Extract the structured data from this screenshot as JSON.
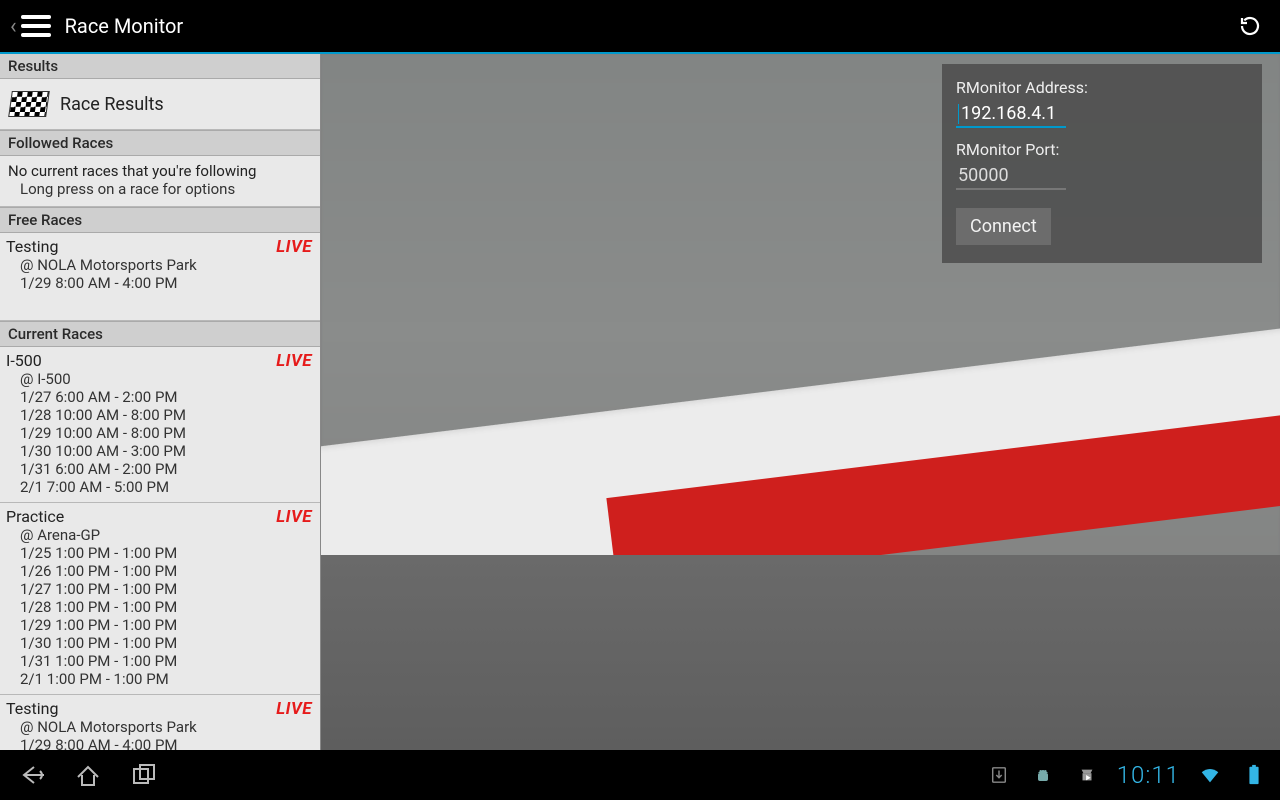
{
  "actionbar": {
    "title": "Race Monitor"
  },
  "sidebar": {
    "sections": {
      "results": {
        "header": "Results",
        "race_results_label": "Race Results"
      },
      "followed": {
        "header": "Followed Races",
        "empty_line": "No current races that you're following",
        "hint": "Long press on a race for options"
      },
      "free": {
        "header": "Free Races"
      },
      "current": {
        "header": "Current Races"
      }
    },
    "free_races": [
      {
        "title": "Testing",
        "live": "LIVE",
        "venue": "@ NOLA Motorsports Park",
        "schedule": [
          "1/29  8:00 AM - 4:00 PM"
        ]
      }
    ],
    "current_races": [
      {
        "title": "I-500",
        "live": "LIVE",
        "venue": "@ I-500",
        "schedule": [
          "1/27  6:00 AM - 2:00 PM",
          "1/28  10:00 AM - 8:00 PM",
          "1/29  10:00 AM - 8:00 PM",
          "1/30  10:00 AM - 3:00 PM",
          "1/31  6:00 AM - 2:00 PM",
          "2/1  7:00 AM - 5:00 PM"
        ]
      },
      {
        "title": "Practice",
        "live": "LIVE",
        "venue": "@ Arena-GP",
        "schedule": [
          "1/25  1:00 PM - 1:00 PM",
          "1/26  1:00 PM - 1:00 PM",
          "1/27  1:00 PM - 1:00 PM",
          "1/28  1:00 PM - 1:00 PM",
          "1/29  1:00 PM - 1:00 PM",
          "1/30  1:00 PM - 1:00 PM",
          "1/31  1:00 PM - 1:00 PM",
          "2/1  1:00 PM - 1:00 PM"
        ]
      },
      {
        "title": "Testing",
        "live": "LIVE",
        "venue": "@ NOLA Motorsports Park",
        "schedule": [
          "1/29  8:00 AM - 4:00 PM"
        ]
      }
    ]
  },
  "panel": {
    "address_label": "RMonitor Address:",
    "address_value": "192.168.4.1",
    "port_label": "RMonitor Port:",
    "port_value": "50000",
    "connect_label": "Connect"
  },
  "statusbar": {
    "clock": "10:11"
  }
}
